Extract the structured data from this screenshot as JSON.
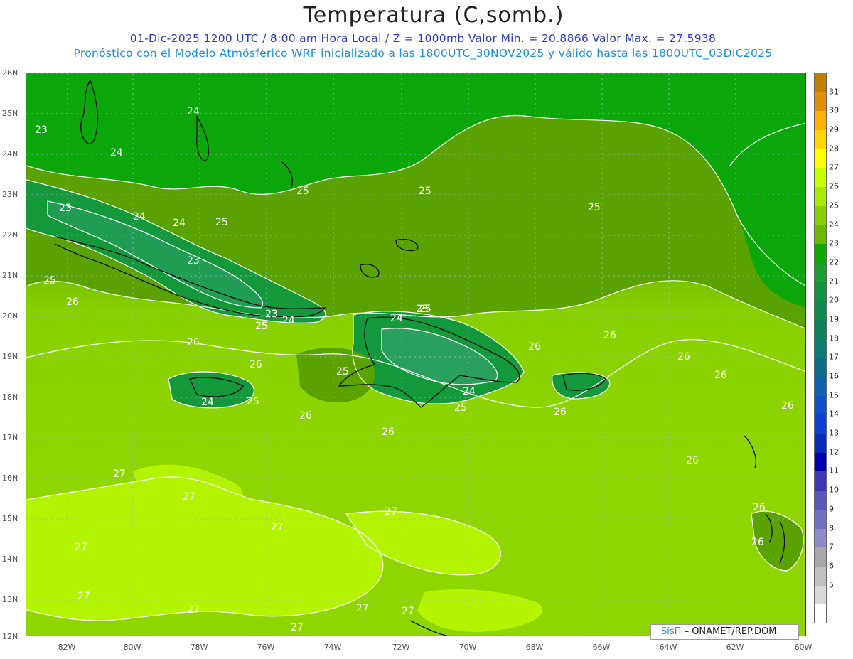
{
  "header": {
    "title": "Temperatura (C,somb.)",
    "line1": "01-Dic-2025  1200 UTC / 8:00 am Hora Local / Z = 1000mb   Valor Min. = 20.8866  Valor Max. = 27.5938",
    "line2": "Pronóstico con el Modelo Atmósferico WRF inicializado a las 1800UTC_30NOV2025 y válido hasta las  1800UTC_03DIC2025"
  },
  "map": {
    "latitude_labels": [
      "26N",
      "25N",
      "24N",
      "23N",
      "22N",
      "21N",
      "20N",
      "19N",
      "18N",
      "17N",
      "16N",
      "15N",
      "14N",
      "13N",
      "12N"
    ],
    "longitude_labels": [
      "82W",
      "80W",
      "78W",
      "76W",
      "74W",
      "72W",
      "70W",
      "68W",
      "66W",
      "64W",
      "62W",
      "60W"
    ],
    "contour_labels": [
      "24",
      "23",
      "24",
      "25",
      "25",
      "25",
      "23",
      "24",
      "25",
      "24",
      "23",
      "25",
      "23",
      "25",
      "24",
      "25",
      "24",
      "25",
      "26",
      "26",
      "26",
      "26",
      "26",
      "26",
      "26",
      "26",
      "26",
      "26",
      "24",
      "25",
      "25",
      "24",
      "25",
      "26",
      "27",
      "27",
      "27",
      "27",
      "27",
      "27",
      "27",
      "27",
      "27",
      "27",
      "26",
      "26",
      "26"
    ]
  },
  "colorbar": {
    "labels": [
      "31",
      "30",
      "29",
      "28",
      "27",
      "26",
      "25",
      "24",
      "23",
      "22",
      "21",
      "20",
      "19",
      "18",
      "17",
      "16",
      "15",
      "14",
      "13",
      "12",
      "11",
      "10",
      "9",
      "8",
      "7",
      "6",
      "5"
    ],
    "colors": [
      "#c08000",
      "#e09000",
      "#ffb000",
      "#ffd700",
      "#ffff00",
      "#c8ff00",
      "#a6ea00",
      "#88d000",
      "#6cb800",
      "#10a800",
      "#1a9c30",
      "#159040",
      "#12884e",
      "#10805a",
      "#0e7a70",
      "#0e6c8a",
      "#1060b0",
      "#1050c8",
      "#1040d0",
      "#0a2ab8",
      "#0000b0",
      "#3838b0",
      "#5858b8",
      "#7070c0",
      "#8c8cc8",
      "#a8a8a8",
      "#c0c0c0",
      "#d8d8d8",
      "#ffffff"
    ]
  },
  "credit": {
    "logo": "SisΠ",
    "org": "– ONAMET/REP.DOM."
  }
}
